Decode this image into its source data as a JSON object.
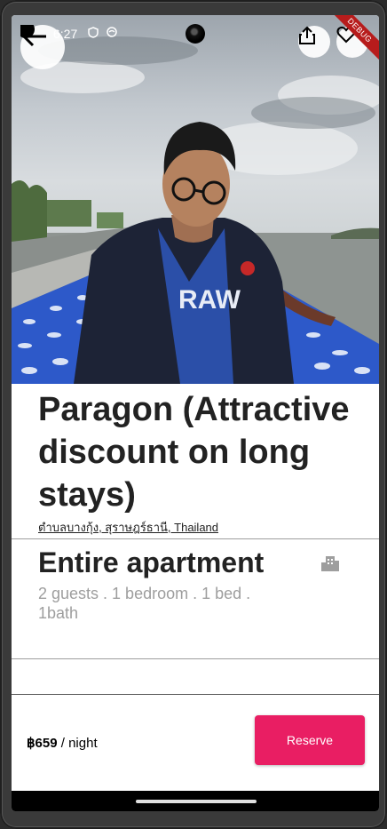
{
  "status_bar": {
    "time": "6:27"
  },
  "debug_banner": "DEBUG",
  "listing": {
    "title": "Paragon (Attractive discount on long stays)",
    "location": "ตำบลบางกุ้ง, สุราษฎร์ธานี, Thailand",
    "property_type": "Entire apartment",
    "details": "2 guests . 1 bedroom . 1 bed . 1bath"
  },
  "booking": {
    "price": "฿659",
    "price_unit": " / night",
    "reserve_label": "Reserve"
  },
  "colors": {
    "accent": "#e91e63",
    "text": "#222222",
    "muted": "#9e9e9e"
  }
}
